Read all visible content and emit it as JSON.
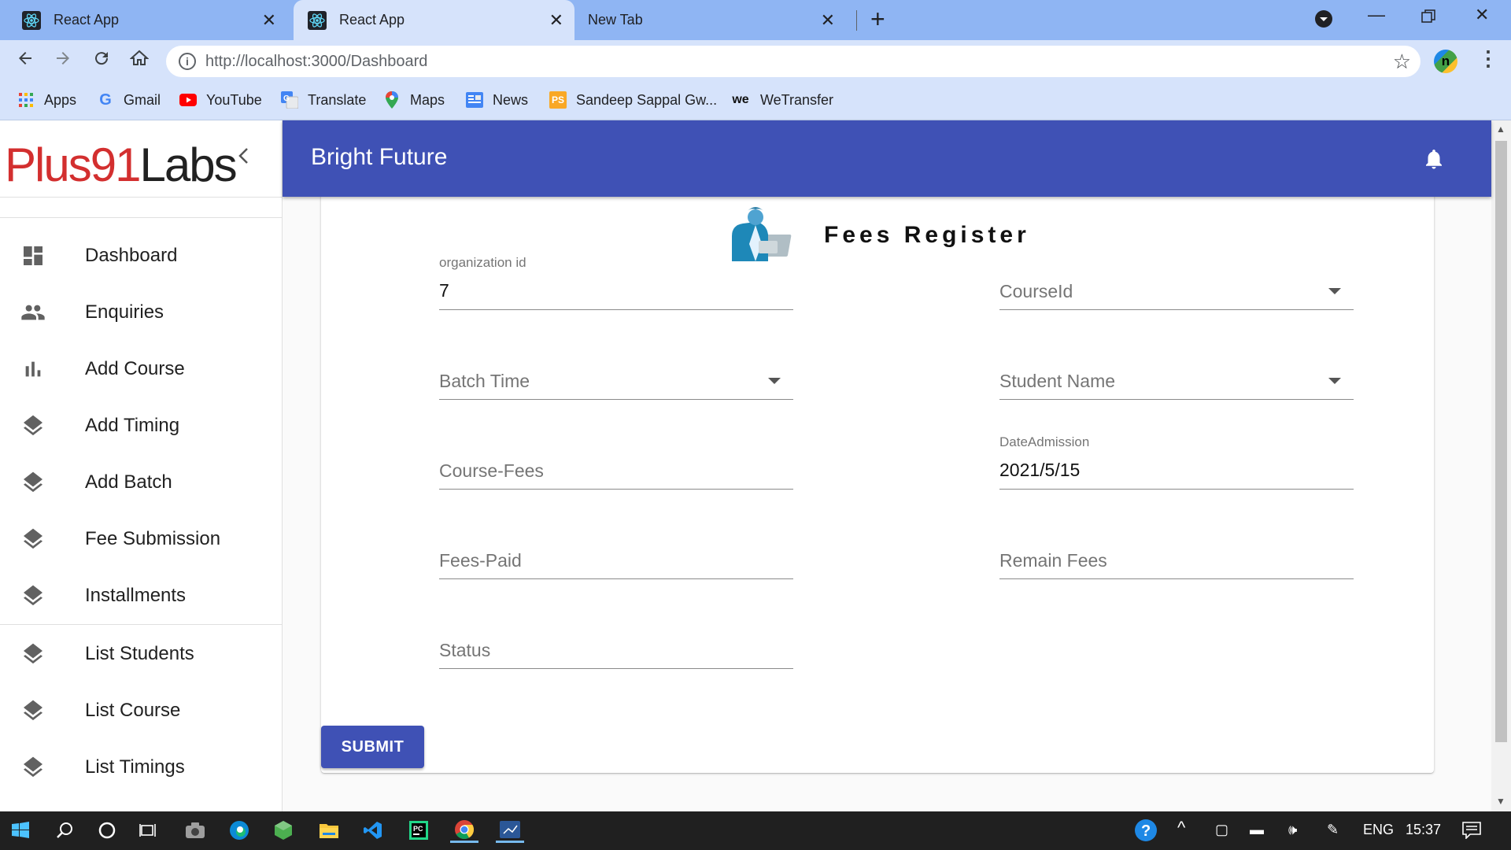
{
  "browser": {
    "tabs": [
      {
        "title": "React App",
        "active": false
      },
      {
        "title": "React App",
        "active": true
      },
      {
        "title": "New Tab",
        "active": false
      }
    ],
    "url": "http://localhost:3000/Dashboard",
    "bookmarks": [
      {
        "label": "Apps",
        "icon": "apps-grid-icon"
      },
      {
        "label": "Gmail",
        "icon": "google-icon"
      },
      {
        "label": "YouTube",
        "icon": "youtube-icon"
      },
      {
        "label": "Translate",
        "icon": "translate-icon"
      },
      {
        "label": "Maps",
        "icon": "maps-icon"
      },
      {
        "label": "News",
        "icon": "news-icon"
      },
      {
        "label": "Sandeep Sappal Gw...",
        "icon": "ps-icon"
      },
      {
        "label": "WeTransfer",
        "icon": "wetransfer-icon"
      }
    ],
    "profile_initial": "n"
  },
  "app": {
    "logo_red": "Plus91",
    "logo_dark": "Labs",
    "header_title": "Bright Future",
    "nav": [
      {
        "label": "Dashboard",
        "icon": "dashboard-icon"
      },
      {
        "label": "Enquiries",
        "icon": "people-icon"
      },
      {
        "label": "Add Course",
        "icon": "bar-chart-icon"
      },
      {
        "label": "Add Timing",
        "icon": "layers-icon"
      },
      {
        "label": "Add Batch",
        "icon": "layers-icon"
      },
      {
        "label": "Fee Submission",
        "icon": "layers-icon"
      },
      {
        "label": "Installments",
        "icon": "layers-icon"
      },
      {
        "label": "List Students",
        "icon": "layers-icon"
      },
      {
        "label": "List Course",
        "icon": "layers-icon"
      },
      {
        "label": "List Timings",
        "icon": "layers-icon"
      }
    ],
    "colors": {
      "primary": "#3f51b5",
      "logo_red": "#d32f2f"
    }
  },
  "form": {
    "title": "Fees Register",
    "fields": {
      "organization_id": {
        "label": "organization id",
        "value": "7"
      },
      "course_id": {
        "label": "CourseId",
        "value": ""
      },
      "batch_time": {
        "label": "Batch Time",
        "value": ""
      },
      "student_name": {
        "label": "Student Name",
        "value": ""
      },
      "course_fees": {
        "label": "Course-Fees",
        "value": ""
      },
      "date_admission": {
        "label": "DateAdmission",
        "value": "2021/5/15"
      },
      "fees_paid": {
        "label": "Fees-Paid",
        "value": ""
      },
      "remain_fees": {
        "label": "Remain Fees",
        "value": ""
      },
      "status": {
        "label": "Status",
        "value": ""
      }
    },
    "submit_label": "SUBMIT"
  },
  "taskbar": {
    "language": "ENG",
    "time": "15:37"
  }
}
